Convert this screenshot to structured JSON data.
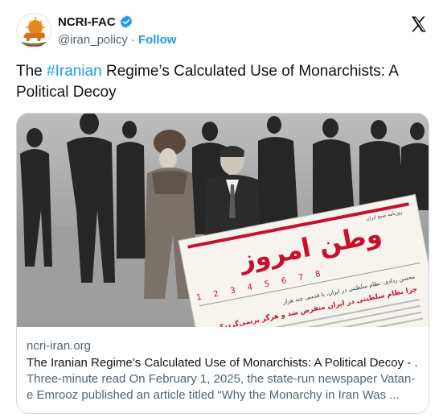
{
  "account": {
    "display_name": "NCRI-FAC",
    "handle": "@iran_policy",
    "follow_label": "Follow"
  },
  "tweet": {
    "text_before": "The ",
    "hashtag": "#Iranian",
    "text_after": " Regime’s Calculated Use of Monarchists: A Political Decoy"
  },
  "card": {
    "domain": "ncri-iran.org",
    "title": "The Iranian Regime’s Calculated Use of Monarchists: A Political Decoy - ...",
    "description": "Three-minute read On February 1, 2025, the state-run newspaper Vatan-e Emrooz published an article titled “Why the Monarchy in Iran Was ..."
  },
  "newspaper": {
    "masthead": "وطن امروز",
    "kicker": "روزنامه صبح ایران",
    "headline": "چرا نظام سلطنتی در ایران منقرض شد و هرگز برنمی‌گردد؟",
    "author": "محسن ردادی: نظام سلطنتی در ایران، با قدمتی چند هزار",
    "numbers": "1 2 3 4 5 6 7 8"
  },
  "colors": {
    "link_blue": "#1d9bf0",
    "masthead_red": "#c8102e",
    "text": "#0f1419",
    "muted": "#536471"
  },
  "icons": {
    "verified": "verified-badge-icon",
    "x": "x-logo-icon"
  }
}
